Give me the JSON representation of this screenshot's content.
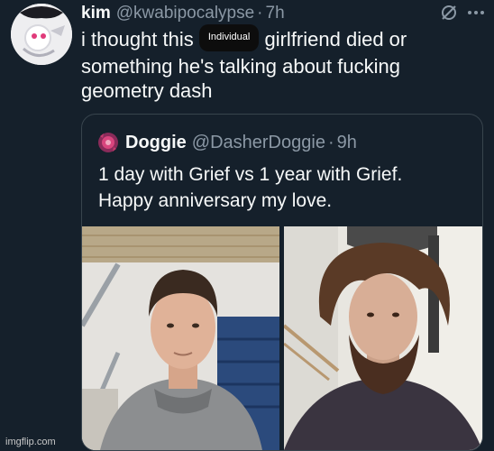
{
  "tweet": {
    "display_name": "kim",
    "handle": "@kwabipocalypse",
    "separator": "·",
    "time": "7h",
    "text_before": "i thought this",
    "redaction_label": "Individual",
    "text_after": "girlfriend died or something he's talking about fucking geometry dash",
    "icons": [
      "grok-icon",
      "more-icon",
      "avatar"
    ]
  },
  "quote": {
    "display_name": "Doggie",
    "handle": "@DasherDoggie",
    "separator": "·",
    "time": "9h",
    "line1": "1 day with Grief vs 1 year with Grief.",
    "line2": "Happy anniversary my love.",
    "photos": [
      "photo-left",
      "photo-right"
    ]
  },
  "watermark": "imgflip.com",
  "colors": {
    "background": "#15202b",
    "text": "#f7f9f9",
    "secondary_text": "#8b98a5",
    "border": "#38444d"
  }
}
